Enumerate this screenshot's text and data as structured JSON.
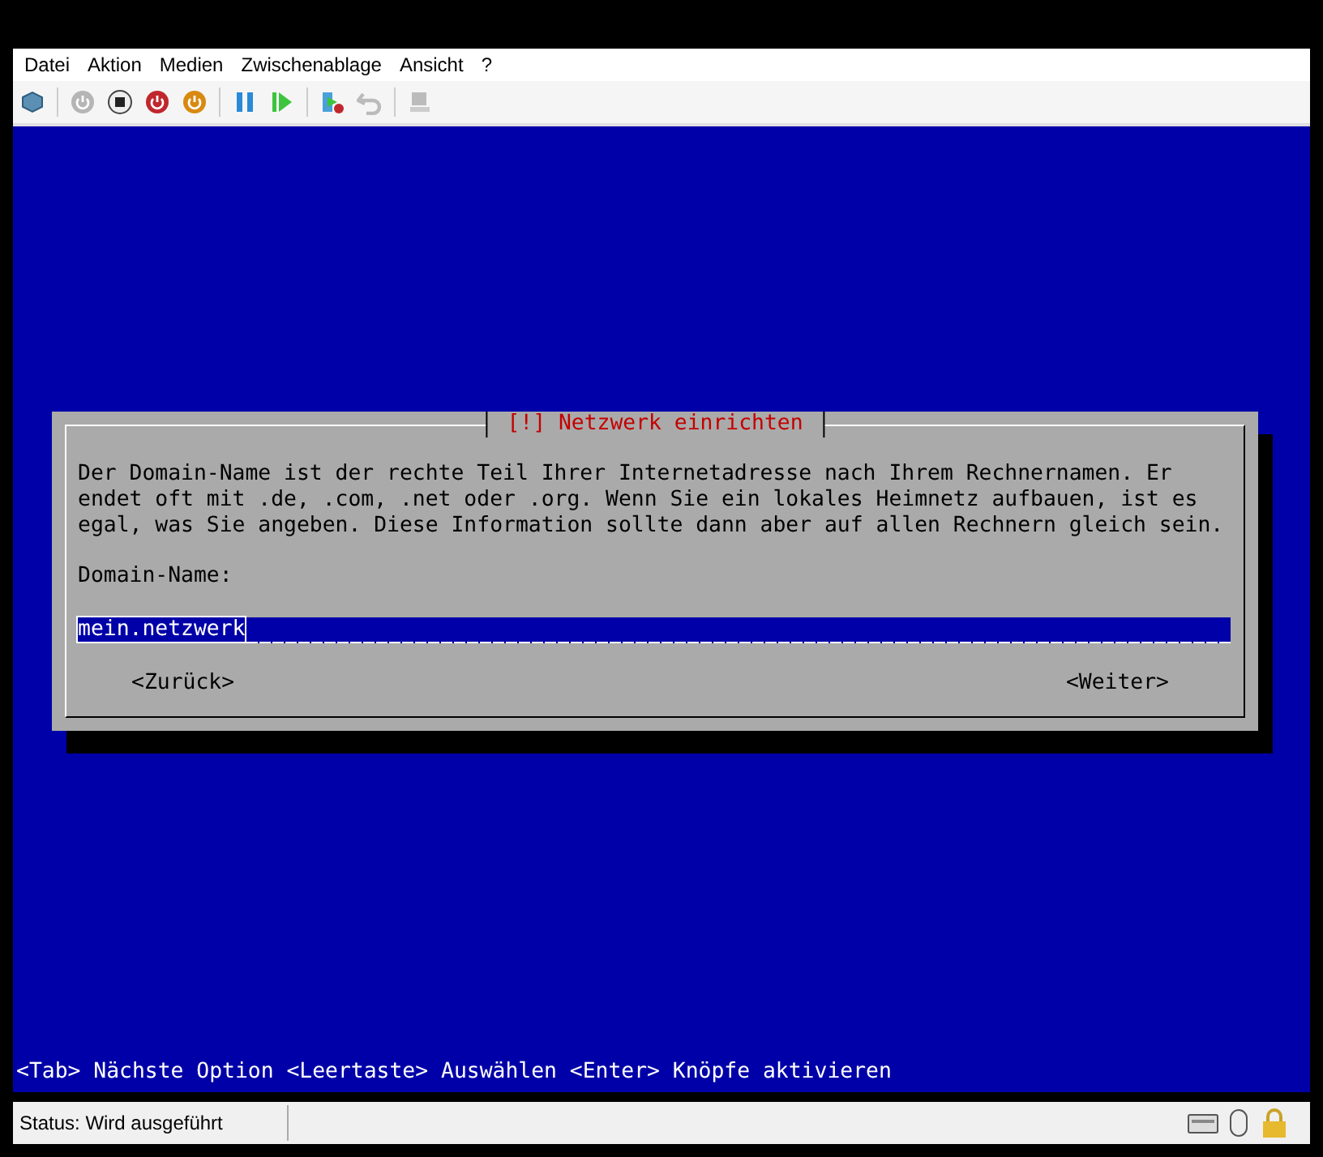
{
  "menu": [
    "Datei",
    "Aktion",
    "Medien",
    "Zwischenablage",
    "Ansicht",
    "?"
  ],
  "dialog": {
    "title": "[!] Netzwerk einrichten",
    "text": "Der Domain-Name ist der rechte Teil Ihrer Internetadresse nach Ihrem Rechnernamen. Er endet oft mit .de, .com, .net oder .org. Wenn Sie ein lokales Heimnetz aufbauen, ist es egal, was Sie angeben. Diese Information sollte dann aber auf allen Rechnern gleich sein.",
    "label": "Domain-Name:",
    "field": {
      "value": "mein.netzwerk"
    },
    "buttons": [
      "<Zurück>",
      "<Weiter>"
    ]
  },
  "help": "<Tab> Nächste Option <Leertaste> Auswählen <Enter> Knöpfe aktivieren",
  "status": "Status: Wird ausgeführt"
}
